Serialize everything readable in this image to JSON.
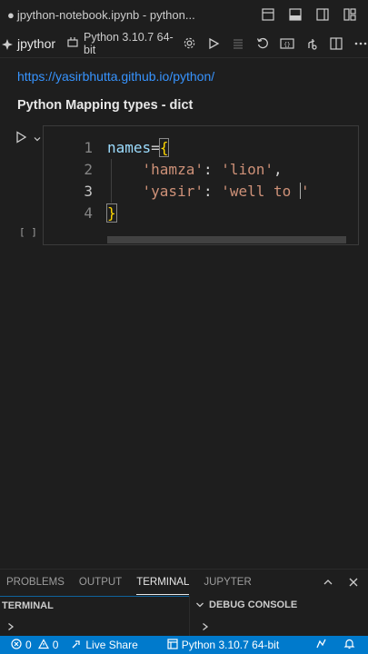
{
  "window": {
    "title_dot": "●",
    "title": "jpython-notebook.ipynb - python..."
  },
  "notebook": {
    "name": "jpythor",
    "kernel_label": "Python 3.10.7 64-bit"
  },
  "markdown": {
    "link": "https://yasirbhutta.github.io/python/",
    "heading": "Python Mapping types - dict"
  },
  "cell": {
    "execution_count": "[ ]",
    "lines": [
      {
        "number": "1",
        "tokens": [
          {
            "t": "names",
            "c": "var"
          },
          {
            "t": "=",
            "c": "op"
          },
          {
            "t": "{",
            "c": "br"
          }
        ]
      },
      {
        "number": "2",
        "tokens": [
          {
            "t": "    ",
            "c": "op"
          },
          {
            "t": "'hamza'",
            "c": "str"
          },
          {
            "t": ": ",
            "c": "op"
          },
          {
            "t": "'lion'",
            "c": "str"
          },
          {
            "t": ",",
            "c": "op"
          }
        ]
      },
      {
        "number": "3",
        "tokens": [
          {
            "t": "    ",
            "c": "op"
          },
          {
            "t": "'yasir'",
            "c": "str"
          },
          {
            "t": ": ",
            "c": "op"
          },
          {
            "t": "'well to ",
            "c": "str"
          },
          {
            "t": "'",
            "c": "str"
          }
        ]
      },
      {
        "number": "4",
        "tokens": [
          {
            "t": "}",
            "c": "br"
          }
        ]
      }
    ]
  },
  "panel": {
    "tabs": [
      "PROBLEMS",
      "OUTPUT",
      "TERMINAL",
      "JUPYTER"
    ],
    "active_tab": "TERMINAL",
    "left_header": "TERMINAL",
    "right_header": "DEBUG CONSOLE"
  },
  "statusbar": {
    "errors": "0",
    "warnings": "0",
    "live_share": "Live Share",
    "interpreter": "Python 3.10.7 64-bit"
  },
  "colors": {
    "accent": "#007acc",
    "link": "#3794ff",
    "string": "#ce9178",
    "variable": "#9cdcfe",
    "bracket": "#ffd700"
  },
  "icons": [
    "file-dot-icon",
    "split-editor-icon",
    "toggle-panel-icon",
    "toggle-sidebar-icon",
    "customize-layout-icon",
    "notebook-icon",
    "kernel-icon",
    "settings-icon",
    "run-all-icon",
    "variables-icon",
    "restart-icon",
    "outline-icon",
    "variables-view-icon",
    "split-icon",
    "more-icon",
    "run-cell-icon",
    "chevron-down-icon",
    "maximize-panel-icon",
    "close-panel-icon",
    "chevron-down-icon",
    "terminal-prompt-icon",
    "error-icon",
    "warning-icon",
    "live-share-icon",
    "python-icon",
    "remote-icon",
    "bell-icon"
  ]
}
